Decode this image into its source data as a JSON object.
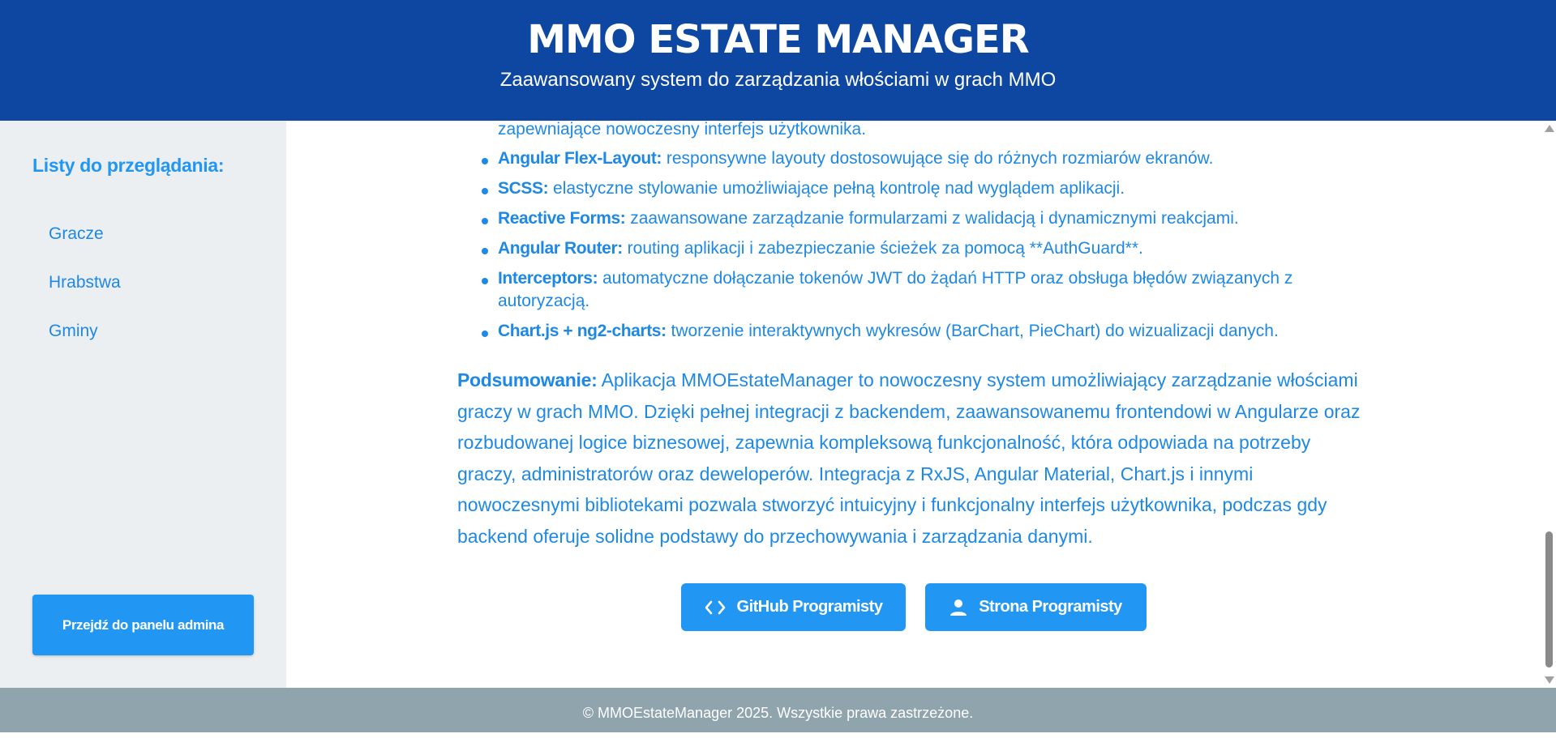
{
  "header": {
    "title": "MMO ESTATE MANAGER",
    "subtitle": "Zaawansowany system do zarządzania włościami w grach MMO"
  },
  "sidebar": {
    "heading": "Listy do przeglądania:",
    "items": [
      {
        "label": "Gracze"
      },
      {
        "label": "Hrabstwa"
      },
      {
        "label": "Gminy"
      }
    ],
    "admin_button": "Przejdź do panelu admina"
  },
  "main": {
    "partial_line": "zapewniające nowoczesny interfejs użytkownika.",
    "tech_list": [
      {
        "name": "Angular Flex-Layout:",
        "desc": " responsywne layouty dostosowujące się do różnych rozmiarów ekranów."
      },
      {
        "name": "SCSS:",
        "desc": " elastyczne stylowanie umożliwiające pełną kontrolę nad wyglądem aplikacji."
      },
      {
        "name": "Reactive Forms:",
        "desc": " zaawansowane zarządzanie formularzami z walidacją i dynamicznymi reakcjami."
      },
      {
        "name": "Angular Router:",
        "desc": " routing aplikacji i zabezpieczanie ścieżek za pomocą **AuthGuard**."
      },
      {
        "name": "Interceptors:",
        "desc": " automatyczne dołączanie tokenów JWT do żądań HTTP oraz obsługa błędów związanych z autoryzacją."
      },
      {
        "name": "Chart.js + ng2-charts:",
        "desc": " tworzenie interaktywnych wykresów (BarChart, PieChart) do wizualizacji danych."
      }
    ],
    "summary_label": "Podsumowanie:",
    "summary_text": " Aplikacja MMOEstateManager to nowoczesny system umożliwiający zarządzanie włościami graczy w grach MMO. Dzięki pełnej integracji z backendem, zaawansowanemu frontendowi w Angularze oraz rozbudowanej logice biznesowej, zapewnia kompleksową funkcjonalność, która odpowiada na potrzeby graczy, administratorów oraz deweloperów. Integracja z RxJS, Angular Material, Chart.js i innymi nowoczesnymi bibliotekami pozwala stworzyć intuicyjny i funkcjonalny interfejs użytkownika, podczas gdy backend oferuje solidne podstawy do przechowywania i zarządzania danymi.",
    "buttons": {
      "github": {
        "label": "GitHub Programisty",
        "icon": "code-icon"
      },
      "website": {
        "label": "Strona Programisty",
        "icon": "person-icon"
      }
    }
  },
  "footer": {
    "text": "© MMOEstateManager 2025.  Wszystkie prawa zastrzeżone."
  },
  "colors": {
    "header_bg": "#0d47a1",
    "accent": "#2196f3",
    "text_blue": "#1e88e5",
    "sidebar_bg": "#eceff1",
    "footer_bg": "#90a4ae"
  }
}
